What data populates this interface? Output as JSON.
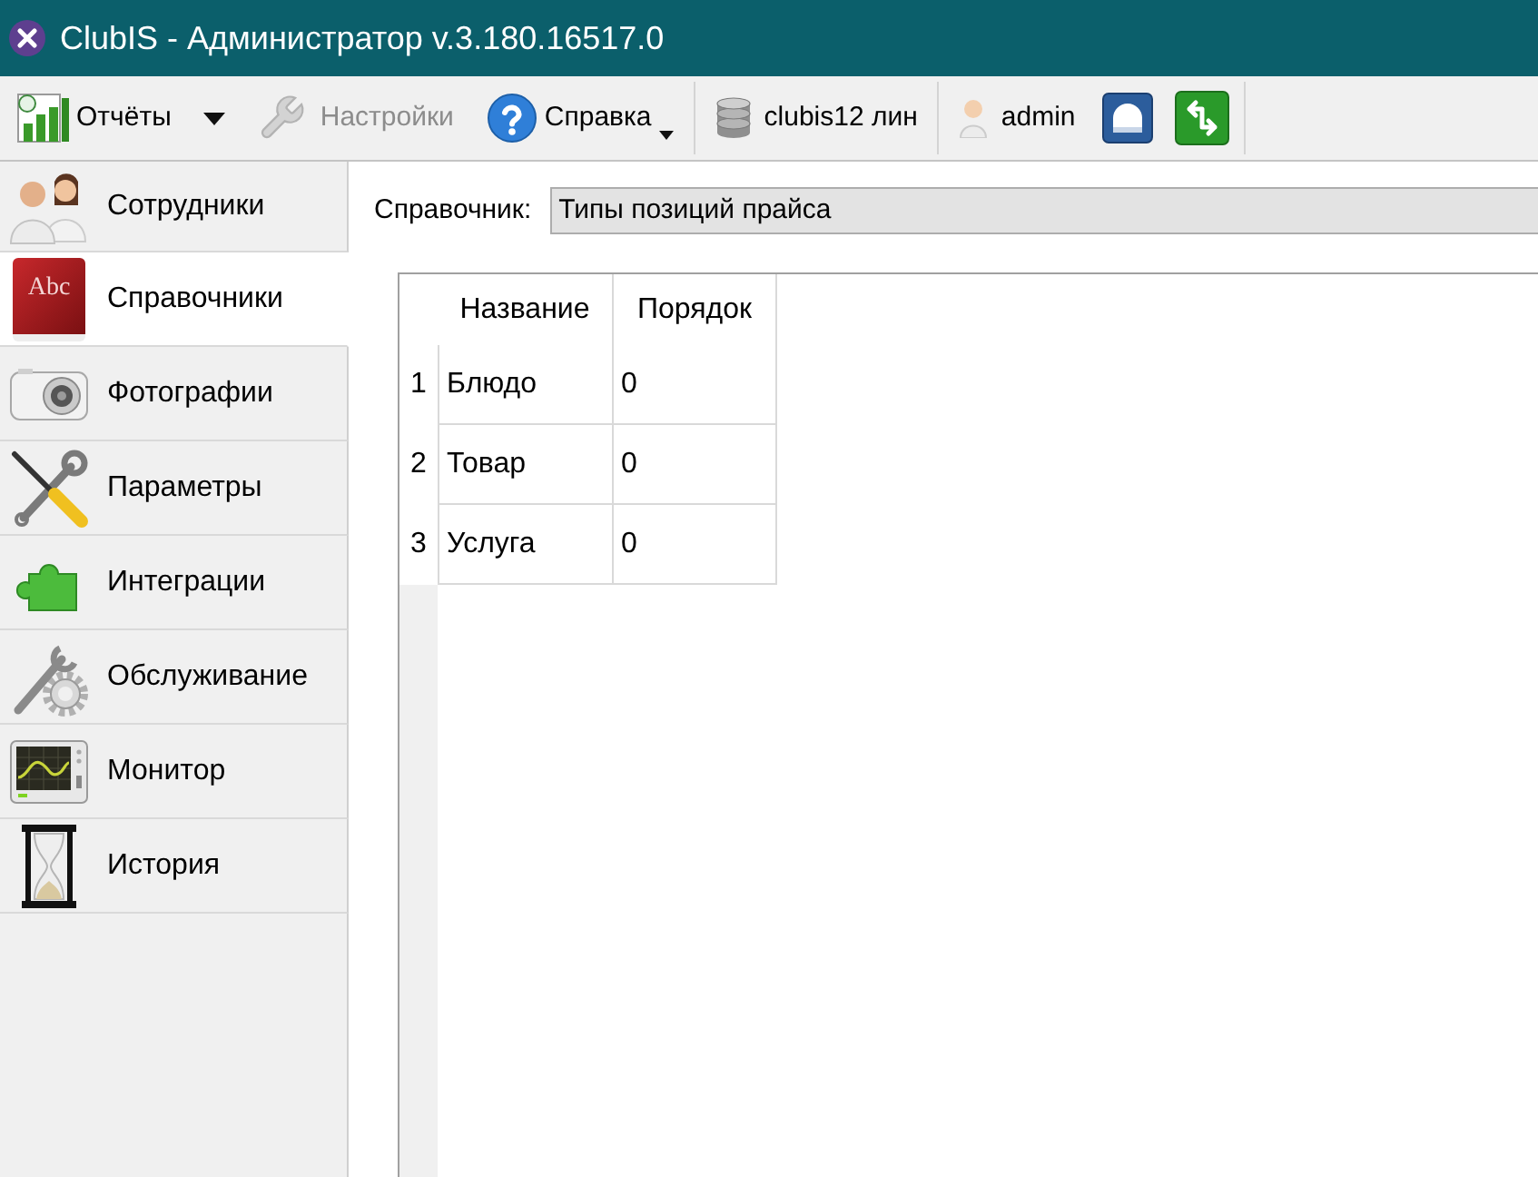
{
  "window": {
    "title": "ClubIS - Администратор v.3.180.16517.0"
  },
  "toolbar": {
    "groups": [
      [
        {
          "kind": "split",
          "label": "Отчёты",
          "disabled": false
        },
        {
          "kind": "button",
          "label": "Настройки",
          "disabled": true
        },
        {
          "kind": "menu",
          "label": "Справка",
          "disabled": false
        }
      ],
      [
        {
          "kind": "button",
          "label": "clubis12 лин",
          "disabled": false
        }
      ],
      [
        {
          "kind": "button",
          "label": "admin",
          "disabled": false
        },
        {
          "kind": "icon",
          "disabled": false
        },
        {
          "kind": "icon",
          "disabled": false
        }
      ]
    ]
  },
  "sidebar": {
    "items": [
      {
        "label": "Сотрудники",
        "selected": false
      },
      {
        "label": "Справочники",
        "selected": true,
        "cover_text": "Abc"
      },
      {
        "label": "Фотографии",
        "selected": false
      },
      {
        "label": "Параметры",
        "selected": false
      },
      {
        "label": "Интеграции",
        "selected": false
      },
      {
        "label": "Обслуживание",
        "selected": false
      },
      {
        "label": "Монитор",
        "selected": false
      },
      {
        "label": "История",
        "selected": false
      }
    ]
  },
  "dictionary": {
    "label": "Справочник:",
    "value": "Типы позиций прайса"
  },
  "table": {
    "columns": [
      "Название",
      "Порядок"
    ],
    "rows": [
      {
        "number": "1",
        "cells": [
          "Блюдо",
          "0"
        ]
      },
      {
        "number": "2",
        "cells": [
          "Товар",
          "0"
        ]
      },
      {
        "number": "3",
        "cells": [
          "Услуга",
          "0"
        ]
      }
    ]
  }
}
